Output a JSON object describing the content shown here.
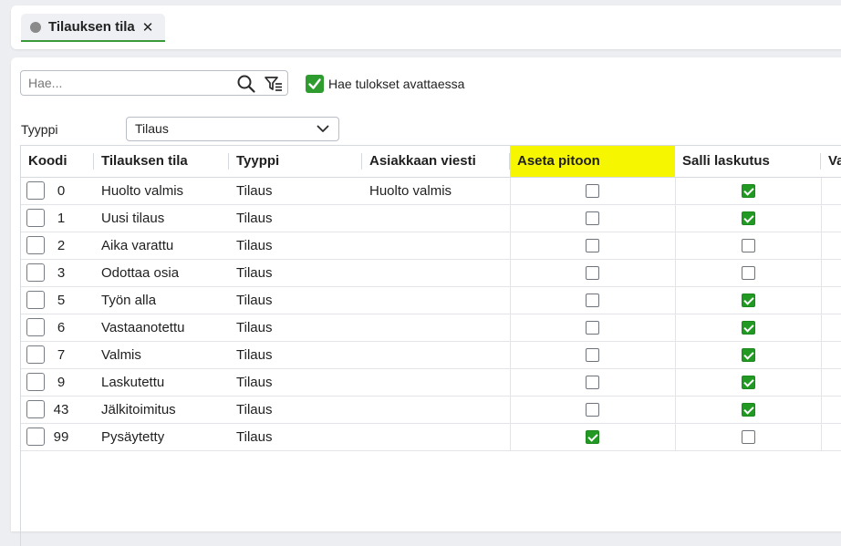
{
  "tab": {
    "label": "Tilauksen tila",
    "close": "✕"
  },
  "search": {
    "placeholder": "Hae...",
    "value": ""
  },
  "search_on_open": {
    "label": "Hae tulokset avattaessa",
    "checked": true
  },
  "filter": {
    "label": "Tyyppi",
    "value": "Tilaus"
  },
  "colors": {
    "highlight": "#f6f600",
    "check": "#229922",
    "tab_accent": "#3a9a3a"
  },
  "grid": {
    "columns": [
      "Koodi",
      "Tilauksen tila",
      "Tyyppi",
      "Asiakkaan viesti",
      "Aseta pitoon",
      "Salli laskutus",
      "Va"
    ],
    "highlighted_column": "Aseta pitoon",
    "rows": [
      {
        "code": "0",
        "status": "Huolto valmis",
        "type": "Tilaus",
        "message": "Huolto valmis",
        "hold": false,
        "invoice": true
      },
      {
        "code": "1",
        "status": "Uusi tilaus",
        "type": "Tilaus",
        "message": "",
        "hold": false,
        "invoice": true
      },
      {
        "code": "2",
        "status": "Aika varattu",
        "type": "Tilaus",
        "message": "",
        "hold": false,
        "invoice": false
      },
      {
        "code": "3",
        "status": "Odottaa osia",
        "type": "Tilaus",
        "message": "",
        "hold": false,
        "invoice": false
      },
      {
        "code": "5",
        "status": "Työn alla",
        "type": "Tilaus",
        "message": "",
        "hold": false,
        "invoice": true
      },
      {
        "code": "6",
        "status": "Vastaanotettu",
        "type": "Tilaus",
        "message": "",
        "hold": false,
        "invoice": true
      },
      {
        "code": "7",
        "status": "Valmis",
        "type": "Tilaus",
        "message": "",
        "hold": false,
        "invoice": true
      },
      {
        "code": "9",
        "status": "Laskutettu",
        "type": "Tilaus",
        "message": "",
        "hold": false,
        "invoice": true
      },
      {
        "code": "43",
        "status": "Jälkitoimitus",
        "type": "Tilaus",
        "message": "",
        "hold": false,
        "invoice": true
      },
      {
        "code": "99",
        "status": "Pysäytetty",
        "type": "Tilaus",
        "message": "",
        "hold": true,
        "invoice": false
      }
    ]
  }
}
